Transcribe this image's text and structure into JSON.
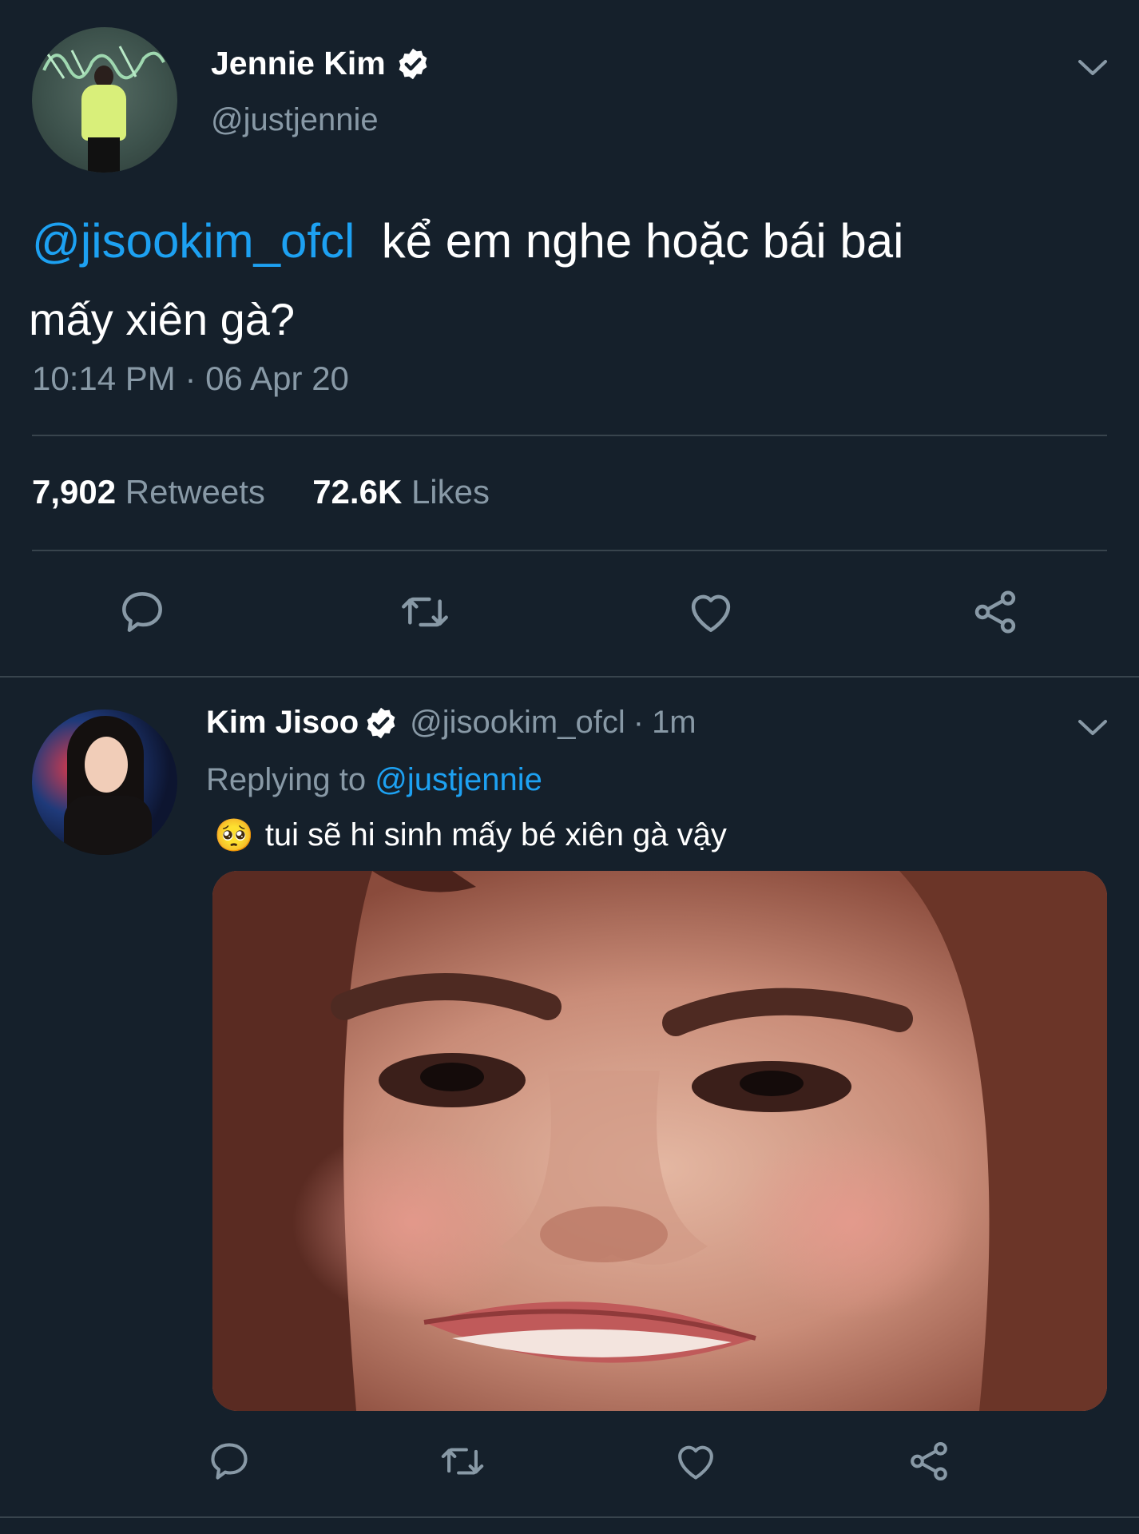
{
  "tweet": {
    "author_name": "Jennie Kim",
    "author_handle": "@justjennie",
    "mention": "@jisookim_ofcl",
    "text_line1": "kể em nghe hoặc bái bai",
    "text_line2": "mấy xiên gà?",
    "timestamp": "10:14 PM · 06 Apr 20",
    "retweets_count": "7,902",
    "retweets_label": "Retweets",
    "likes_count": "72.6K",
    "likes_label": "Likes",
    "avatar_icon": "avatar-photo"
  },
  "reply": {
    "author_name": "Kim Jisoo",
    "author_handle": "@jisookim_ofcl",
    "time_sep": "·",
    "time": "1m",
    "replying_label": "Replying to",
    "replying_to": "@justjennie",
    "emoji": "🥺",
    "text": "tui sẽ hi sinh mấy bé xiên gà vậy",
    "media_icon": "attached-photo"
  },
  "icons": {
    "verified": "verified-badge-icon",
    "chevron": "chevron-down-icon",
    "reply": "reply-icon",
    "retweet": "retweet-icon",
    "like": "heart-icon",
    "share": "share-icon"
  },
  "colors": {
    "background": "#15202b",
    "link": "#1da1f2",
    "muted": "#8899a6",
    "divider": "#38444d"
  }
}
